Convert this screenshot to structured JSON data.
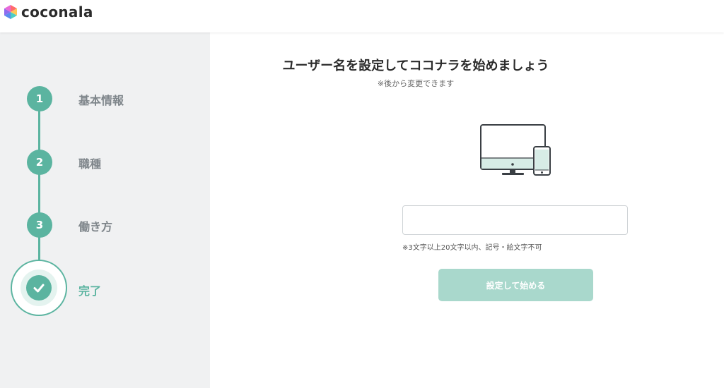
{
  "header": {
    "brand": "coconala",
    "logo_icon": "coconala-logo-icon"
  },
  "sidebar": {
    "steps": [
      {
        "number": "1",
        "label": "基本情報",
        "status": "completed"
      },
      {
        "number": "2",
        "label": "職種",
        "status": "completed"
      },
      {
        "number": "3",
        "label": "働き方",
        "status": "completed"
      },
      {
        "number": "",
        "label": "完了",
        "status": "current",
        "icon": "check-icon"
      }
    ]
  },
  "main": {
    "title": "ユーザー名を設定してココナラを始めましょう",
    "subtitle": "※後から変更できます",
    "illustration_icon": "devices-icon",
    "username_input": {
      "value": "",
      "placeholder": ""
    },
    "hint": "※3文字以上20文字以内、記号・絵文字不可",
    "submit_label": "設定して始める"
  },
  "colors": {
    "accent": "#5bb4a0",
    "button_disabled": "#a9d8cc",
    "sidebar_bg": "#f0f1f2"
  }
}
